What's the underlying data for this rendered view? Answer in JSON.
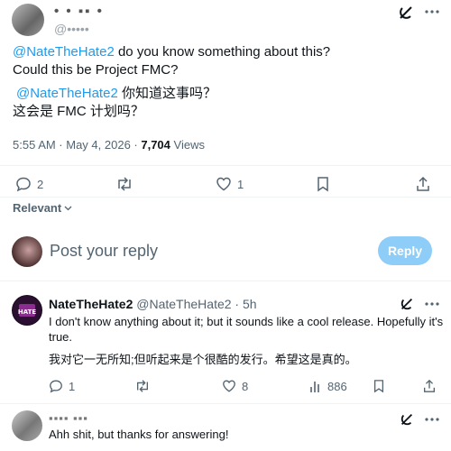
{
  "main_tweet": {
    "author_name": "• • ▪▪ •",
    "author_handle": "@•••••",
    "mention": "@NateTheHate2",
    "text_line1_rest": " do you know something about this?",
    "text_line2": "Could this be Project FMC?",
    "translated_mention": "@NateTheHate2",
    "translated_line1_rest": "  你知道这事吗？",
    "translated_line2": "这会是 FMC 计划吗？",
    "timestamp": "5:55 AM · May 4, 2026 · ",
    "views_count": "7,704",
    "views_label": " Views",
    "replies": "2",
    "likes": "1"
  },
  "relevant_label": "Relevant",
  "composer": {
    "placeholder": "Post your reply",
    "reply_button": "Reply"
  },
  "reply1": {
    "name": "NateTheHate2",
    "handle": "@NateTheHate2 · 5h",
    "text_line1": "I don't know anything about it; but it sounds like a cool release. Hopefully it's",
    "text_line2": "true.",
    "translated": "我对它一无所知;但听起来是个很酷的发行。希望这是真的。",
    "replies": "1",
    "likes": "8",
    "views": "886"
  },
  "reply2": {
    "name": "▪▪▪▪ ▪▪▪",
    "text": "Ahh shit, but thanks for answering!"
  },
  "colors": {
    "accent": "#1d9bf0",
    "muted": "#536471",
    "reply_button": "#8ecdf7"
  }
}
